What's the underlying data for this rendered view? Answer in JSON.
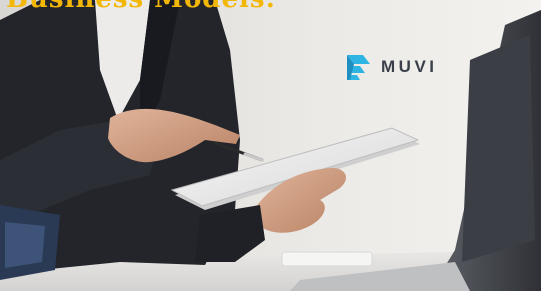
{
  "heading": {
    "text": "Business Models:",
    "color": "#f2b707"
  },
  "logo": {
    "wordmark": "MUVI",
    "icon": "muvi-logo-icon",
    "accent_color": "#2fb5e4"
  },
  "photo": {
    "subject": "hands-holding-tablet-icon"
  }
}
